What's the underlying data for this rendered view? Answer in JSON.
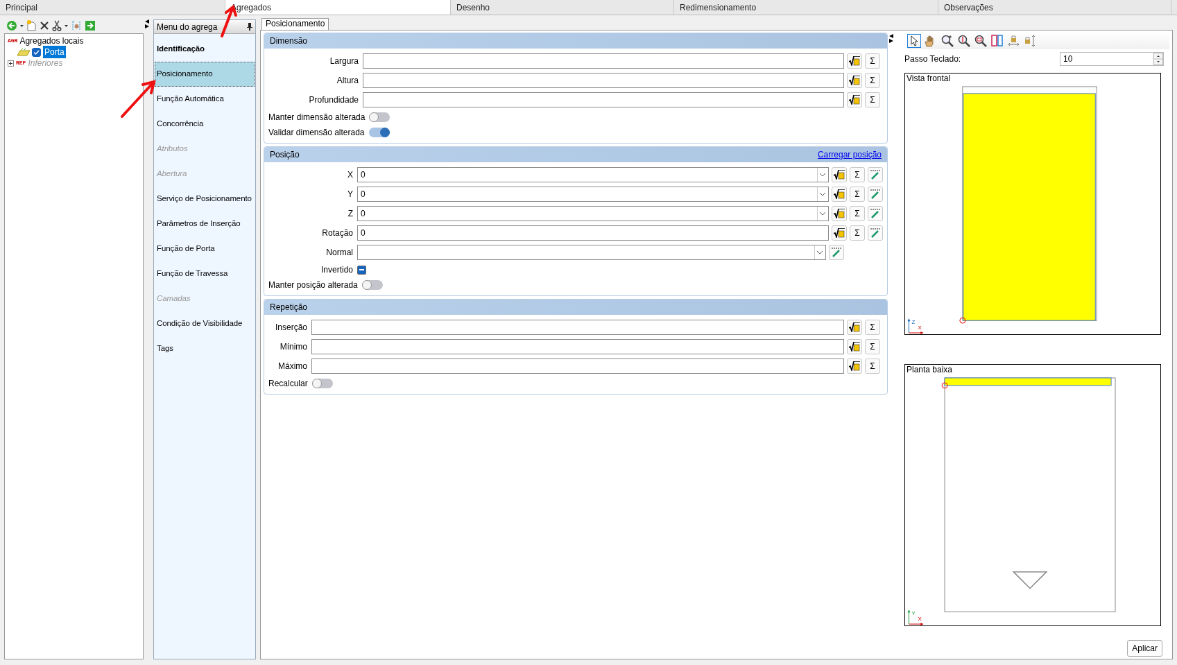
{
  "main_tabs": [
    {
      "label": "Principal",
      "selected": false
    },
    {
      "label": "Agregados",
      "selected": true
    },
    {
      "label": "Desenho",
      "selected": false
    },
    {
      "label": "Redimensionamento",
      "selected": false
    },
    {
      "label": "Observações",
      "selected": false
    }
  ],
  "tree": {
    "items": [
      {
        "tag": "AGR",
        "label": "Agregados locais",
        "selected": false,
        "disabled": false,
        "expanded": true,
        "children": [
          {
            "label": "Porta",
            "checked": true,
            "selected": true
          }
        ]
      },
      {
        "tag": "REF",
        "label": "Inferiores",
        "selected": false,
        "disabled": true,
        "expanded": false
      }
    ]
  },
  "menu": {
    "title": "Menu do agrega",
    "items": [
      {
        "label": "Identificação",
        "kind": "heading",
        "selected": false,
        "disabled": false
      },
      {
        "label": "Posicionamento",
        "kind": "item",
        "selected": true,
        "disabled": false
      },
      {
        "label": "Função Automática",
        "kind": "item",
        "selected": false,
        "disabled": false
      },
      {
        "label": "Concorrência",
        "kind": "item",
        "selected": false,
        "disabled": false
      },
      {
        "label": "Atributos",
        "kind": "item",
        "selected": false,
        "disabled": true
      },
      {
        "label": "Abertura",
        "kind": "item",
        "selected": false,
        "disabled": true
      },
      {
        "label": "Serviço de Posicionamento",
        "kind": "item",
        "selected": false,
        "disabled": false
      },
      {
        "label": "Parâmetros de Inserção",
        "kind": "item",
        "selected": false,
        "disabled": false
      },
      {
        "label": "Função de Porta",
        "kind": "item",
        "selected": false,
        "disabled": false
      },
      {
        "label": "Função de Travessa",
        "kind": "item",
        "selected": false,
        "disabled": false
      },
      {
        "label": "Camadas",
        "kind": "item",
        "selected": false,
        "disabled": true
      },
      {
        "label": "Condição de Visibilidade",
        "kind": "item",
        "selected": false,
        "disabled": false
      },
      {
        "label": "Tags",
        "kind": "item",
        "selected": false,
        "disabled": false
      }
    ]
  },
  "inner_tabs": [
    {
      "label": "Posicionamento",
      "selected": true
    }
  ],
  "sections": [
    {
      "kind": "dimension",
      "title": "Dimensão",
      "rows": [
        {
          "kind": "field",
          "label": "Largura",
          "value": "",
          "dropdown": false,
          "buttons": [
            {
              "kind": "formula"
            },
            {
              "kind": "sum",
              "label": "Σ"
            }
          ]
        },
        {
          "kind": "field",
          "label": "Altura",
          "value": "",
          "dropdown": false,
          "buttons": [
            {
              "kind": "formula"
            },
            {
              "kind": "sum",
              "label": "Σ"
            }
          ]
        },
        {
          "kind": "field",
          "label": "Profundidade",
          "value": "",
          "dropdown": false,
          "buttons": [
            {
              "kind": "formula"
            },
            {
              "kind": "sum",
              "label": "Σ"
            }
          ]
        },
        {
          "kind": "toggle",
          "label": "Manter dimensão alterada",
          "on": false
        },
        {
          "kind": "toggle",
          "label": "Validar dimensão alterada",
          "on": true
        }
      ]
    },
    {
      "kind": "position",
      "title": "Posição",
      "link": "Carregar posição",
      "rows": [
        {
          "kind": "field",
          "label": "X",
          "value": "0",
          "dropdown": true,
          "buttons": [
            {
              "kind": "formula"
            },
            {
              "kind": "sum",
              "label": "Σ"
            },
            {
              "kind": "pick"
            }
          ]
        },
        {
          "kind": "field",
          "label": "Y",
          "value": "0",
          "dropdown": true,
          "buttons": [
            {
              "kind": "formula"
            },
            {
              "kind": "sum",
              "label": "Σ"
            },
            {
              "kind": "pick"
            }
          ]
        },
        {
          "kind": "field",
          "label": "Z",
          "value": "0",
          "dropdown": true,
          "buttons": [
            {
              "kind": "formula"
            },
            {
              "kind": "sum",
              "label": "Σ"
            },
            {
              "kind": "pick"
            }
          ]
        },
        {
          "kind": "field",
          "label": "Rotação",
          "value": "0",
          "dropdown": false,
          "buttons": [
            {
              "kind": "formula"
            },
            {
              "kind": "sum",
              "label": "Σ"
            },
            {
              "kind": "pick"
            }
          ]
        },
        {
          "kind": "field",
          "label": "Normal",
          "value": "",
          "dropdown": true,
          "buttons": [
            {
              "kind": "pick"
            }
          ]
        },
        {
          "kind": "checkbox",
          "label": "Invertido",
          "indeterminate": true
        },
        {
          "kind": "toggle",
          "label": "Manter posição alterada",
          "on": false
        }
      ]
    },
    {
      "kind": "repetition",
      "title": "Repetição",
      "rows": [
        {
          "kind": "field",
          "label": "Inserção",
          "value": "",
          "dropdown": false,
          "buttons": [
            {
              "kind": "formula"
            },
            {
              "kind": "sum",
              "label": "Σ"
            }
          ]
        },
        {
          "kind": "field",
          "label": "Mínimo",
          "value": "",
          "dropdown": false,
          "buttons": [
            {
              "kind": "formula"
            },
            {
              "kind": "sum",
              "label": "Σ"
            }
          ]
        },
        {
          "kind": "field",
          "label": "Máximo",
          "value": "",
          "dropdown": false,
          "buttons": [
            {
              "kind": "formula"
            },
            {
              "kind": "sum",
              "label": "Σ"
            }
          ]
        },
        {
          "kind": "toggle",
          "label": "Recalcular",
          "on": false
        }
      ]
    }
  ],
  "preview": {
    "step": {
      "label": "Passo Teclado:",
      "value": "10"
    },
    "views": [
      {
        "kind": "front",
        "title": "Vista frontal",
        "axes": [
          "Z",
          "X"
        ]
      },
      {
        "kind": "plan",
        "title": "Planta baixa",
        "axes": [
          "Y",
          "X"
        ]
      }
    ],
    "apply_button": "Aplicar"
  }
}
